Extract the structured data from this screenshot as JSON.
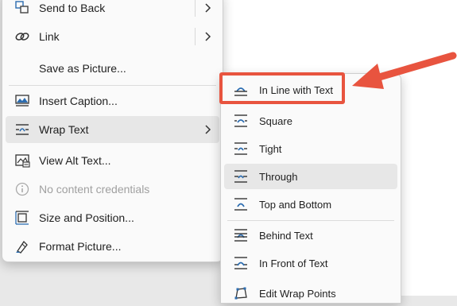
{
  "context_menu": {
    "items": [
      {
        "label": "Send to Back",
        "icon": "send-to-back-icon",
        "has_submenu": true
      },
      {
        "label": "Link",
        "icon": "link-icon",
        "has_submenu": true
      },
      {
        "label": "Save as Picture...",
        "icon": null
      },
      {
        "label": "Insert Caption...",
        "icon": "insert-caption-icon"
      },
      {
        "label": "Wrap Text",
        "icon": "wrap-text-icon",
        "has_submenu": true,
        "highlighted": true
      },
      {
        "label": "View Alt Text...",
        "icon": "alt-text-icon"
      },
      {
        "label": "No content credentials",
        "icon": "info-icon",
        "disabled": true
      },
      {
        "label": "Size and Position...",
        "icon": "size-position-icon"
      },
      {
        "label": "Format Picture...",
        "icon": "format-picture-icon"
      }
    ]
  },
  "wrap_submenu": {
    "items": [
      {
        "label": "In Line with Text",
        "icon": "in-line-with-text-icon"
      },
      {
        "label": "Square",
        "icon": "square-wrap-icon"
      },
      {
        "label": "Tight",
        "icon": "tight-wrap-icon"
      },
      {
        "label": "Through",
        "icon": "through-wrap-icon",
        "highlighted": true
      },
      {
        "label": "Top and Bottom",
        "icon": "top-bottom-wrap-icon"
      },
      {
        "label": "Behind Text",
        "icon": "behind-text-icon"
      },
      {
        "label": "In Front of Text",
        "icon": "in-front-of-text-icon"
      },
      {
        "label": "Edit Wrap Points",
        "icon": "edit-wrap-points-icon"
      }
    ]
  },
  "colors": {
    "callout": "#e8543f",
    "menu_bg": "#fafafa",
    "highlight": "#e7e7e7",
    "icon_blue": "#2b6cb0"
  }
}
